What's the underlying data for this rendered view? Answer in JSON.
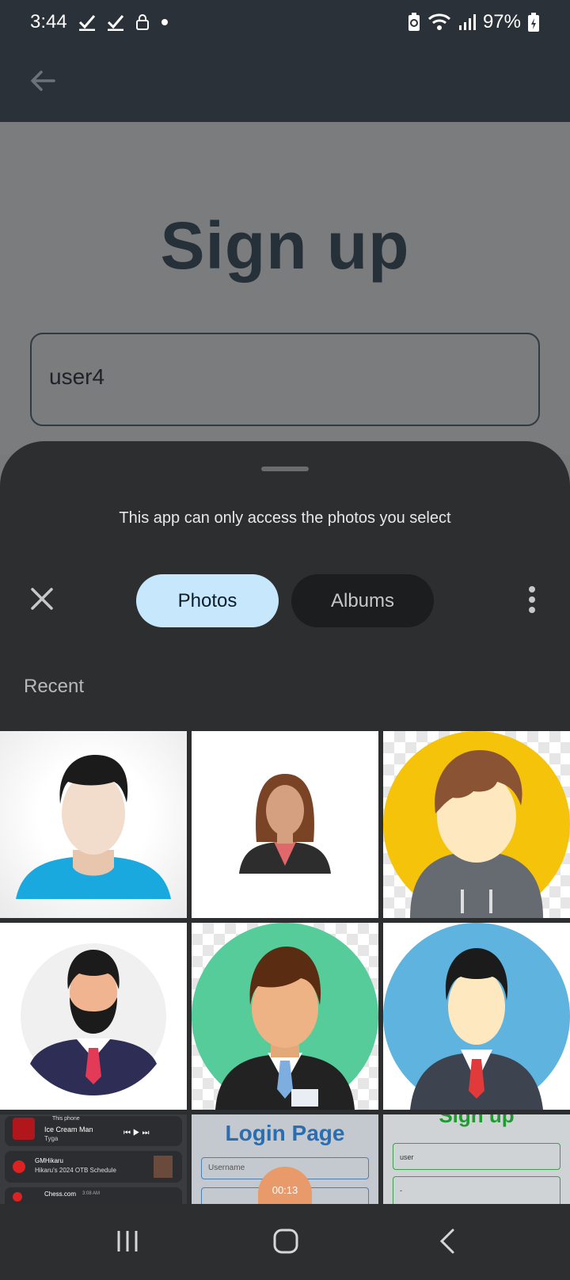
{
  "status_bar": {
    "time": "3:44",
    "battery": "97%"
  },
  "signup": {
    "title": "Sign up",
    "username_value": "user4"
  },
  "picker": {
    "notice": "This app can only access the photos you select",
    "tabs": [
      {
        "label": "Photos",
        "selected": true
      },
      {
        "label": "Albums",
        "selected": false
      }
    ],
    "section_label": "Recent"
  },
  "thumbnails": {
    "notification": {
      "source": "This phone",
      "song": "Ice Cream Man",
      "artist": "Tyga",
      "channel": "GMHikaru",
      "video_title": "Hikaru's 2024 OTB Schedule",
      "app": "Chess.com",
      "time": "3:08 AM"
    },
    "login": {
      "title": "Login Page",
      "field": "Username",
      "duration": "00:13"
    },
    "signup_shot": {
      "title": "Sign up",
      "field_value": "user",
      "second_value": "-"
    }
  },
  "colors": {
    "appbar": "#2a3138",
    "sheet": "#2d2e30",
    "photos_tab": "#c6e7fc",
    "albums_tab": "#1c1d1f"
  }
}
